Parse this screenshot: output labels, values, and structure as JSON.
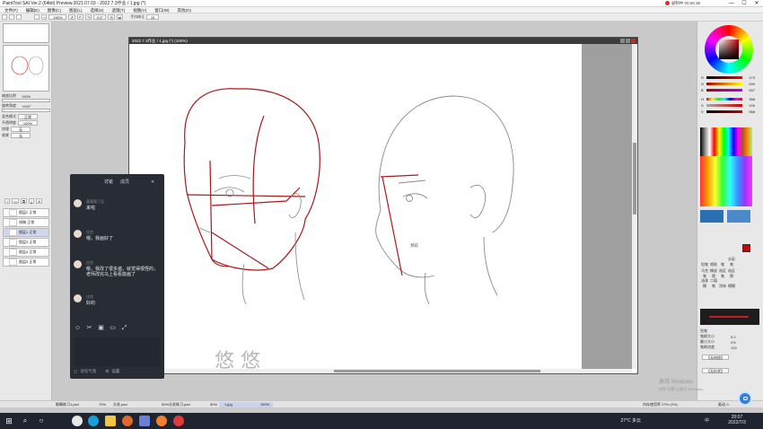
{
  "app": {
    "title": "PaintTool SAI Ver.2 (64bit) Preview.2021.07.03 - 2022.7.3作业 / 1.jpg (*)",
    "recording_timer": "录制中 00:06:38",
    "window_controls": [
      "—",
      "☐",
      "✕"
    ]
  },
  "menubar": {
    "items": [
      "文件(F)",
      "编辑(E)",
      "图像(C)",
      "图层(L)",
      "选择(S)",
      "滤镜(T)",
      "视图(V)",
      "窗口(W)",
      "其他(O)"
    ]
  },
  "toolbar": {
    "zoom_value": "150%",
    "angle_value": "0.0°",
    "stabilizer_label": "手抖修正",
    "stabilizer_value": "15"
  },
  "left_panel": {
    "sliders": [
      {
        "label": "缩放比例",
        "value": "150%"
      },
      {
        "label": "旋转角度",
        "value": "+000°"
      }
    ],
    "properties": [
      {
        "label": "混合模式",
        "value": "正常"
      },
      {
        "label": "不透明度",
        "value": "100%"
      },
      {
        "label": "纹理",
        "value": "无"
      },
      {
        "label": "效果",
        "value": "无"
      }
    ],
    "layers": [
      {
        "name": "图层2",
        "mode": "正常",
        "opacity": "100%",
        "selected": false
      },
      {
        "name": "线稿",
        "mode": "正常",
        "opacity": "100%",
        "selected": false
      },
      {
        "name": "图层1",
        "mode": "正常",
        "opacity": "100%",
        "selected": true
      },
      {
        "name": "图层3",
        "mode": "正常",
        "opacity": "100%",
        "selected": false
      },
      {
        "name": "图层4",
        "mode": "正常",
        "opacity": "100%",
        "selected": false
      },
      {
        "name": "图层5",
        "mode": "正常",
        "opacity": "100%",
        "selected": false
      }
    ]
  },
  "canvas": {
    "title": "2022.7.3作业 / 1.jpg (*) (150%)",
    "label_text": "颈前",
    "watermark": "悠 悠"
  },
  "chat": {
    "tabs": [
      "讨论",
      "成员"
    ],
    "messages": [
      {
        "name": "墨墨睡了没",
        "text": "来啦"
      },
      {
        "name": "佳悠",
        "text": "嗯，我画好了"
      },
      {
        "name": "佳悠",
        "text": "嗯，我改了很多遍，就觉得很怪的，老师改完马上看看能画了"
      },
      {
        "name": "佳悠",
        "text": "好的"
      }
    ],
    "footer": {
      "left": "讨论气泡",
      "right": "设置"
    }
  },
  "right_panel": {
    "rgb": [
      {
        "label": "R",
        "value": "173"
      },
      {
        "label": "G",
        "value": "000"
      },
      {
        "label": "B",
        "value": "007"
      },
      {
        "label": "H",
        "value": "358"
      },
      {
        "label": "S",
        "value": "100"
      },
      {
        "label": "V",
        "value": "068"
      }
    ],
    "brush_name": "铅笔",
    "brush_size_label": "笔刷大小",
    "brush_size": "5.0",
    "min_size_label": "最小大小",
    "min_size": "0%",
    "density_label": "笔刷浓度",
    "density": "100",
    "texture_label": "【无材质】",
    "shape_label": "【无形状】",
    "tools_row1": [
      "铅笔",
      "喷枪",
      "笔",
      "水彩笔"
    ],
    "tools_row2": [
      "马克笔",
      "橡皮擦",
      "选区笔",
      "选区擦"
    ],
    "tools_row3": [
      "油漆桶",
      "二值笔",
      "涂抹",
      "模糊"
    ]
  },
  "statusbar": {
    "files": [
      {
        "name": "眼睛练习1.psd",
        "pct": "70%"
      },
      {
        "name": "头发.psd",
        "pct": "50%"
      },
      {
        "name": "头发练习.psd",
        "pct": "50%"
      },
      {
        "name": "1.jpg",
        "pct": "150%"
      }
    ],
    "memory": "内存使用率 27% (2%)",
    "drive": "驱动 C:"
  },
  "activation": {
    "line1": "激活 Windows",
    "line2": "转到\"设置\"以激活 Windows。"
  },
  "taskbar": {
    "weather": "27°C 多云",
    "time": "20:07",
    "date": "2022/7/3",
    "lang": "中"
  },
  "colors": {
    "accent_red": "#c00000",
    "chat_bg": "#282d35",
    "taskbar_bg": "#1f2430"
  }
}
